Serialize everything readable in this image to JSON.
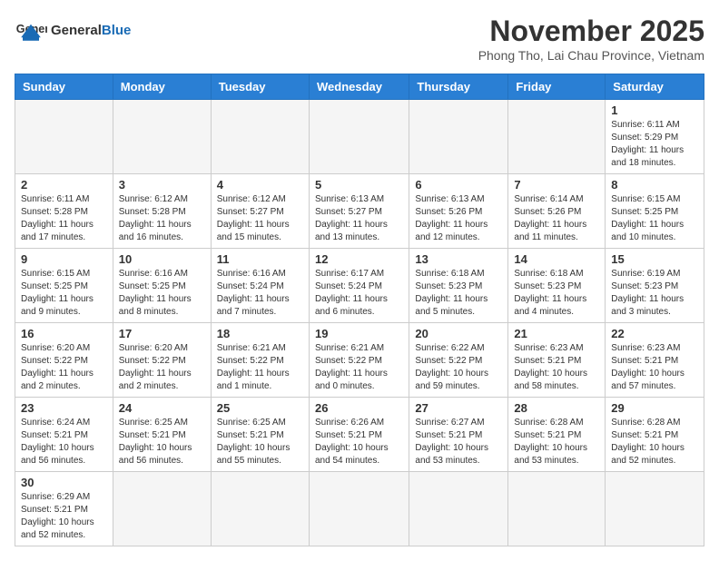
{
  "header": {
    "logo_general": "General",
    "logo_blue": "Blue",
    "month_year": "November 2025",
    "location": "Phong Tho, Lai Chau Province, Vietnam"
  },
  "weekdays": [
    "Sunday",
    "Monday",
    "Tuesday",
    "Wednesday",
    "Thursday",
    "Friday",
    "Saturday"
  ],
  "weeks": [
    [
      {
        "day": "",
        "info": ""
      },
      {
        "day": "",
        "info": ""
      },
      {
        "day": "",
        "info": ""
      },
      {
        "day": "",
        "info": ""
      },
      {
        "day": "",
        "info": ""
      },
      {
        "day": "",
        "info": ""
      },
      {
        "day": "1",
        "info": "Sunrise: 6:11 AM\nSunset: 5:29 PM\nDaylight: 11 hours and 18 minutes."
      }
    ],
    [
      {
        "day": "2",
        "info": "Sunrise: 6:11 AM\nSunset: 5:28 PM\nDaylight: 11 hours and 17 minutes."
      },
      {
        "day": "3",
        "info": "Sunrise: 6:12 AM\nSunset: 5:28 PM\nDaylight: 11 hours and 16 minutes."
      },
      {
        "day": "4",
        "info": "Sunrise: 6:12 AM\nSunset: 5:27 PM\nDaylight: 11 hours and 15 minutes."
      },
      {
        "day": "5",
        "info": "Sunrise: 6:13 AM\nSunset: 5:27 PM\nDaylight: 11 hours and 13 minutes."
      },
      {
        "day": "6",
        "info": "Sunrise: 6:13 AM\nSunset: 5:26 PM\nDaylight: 11 hours and 12 minutes."
      },
      {
        "day": "7",
        "info": "Sunrise: 6:14 AM\nSunset: 5:26 PM\nDaylight: 11 hours and 11 minutes."
      },
      {
        "day": "8",
        "info": "Sunrise: 6:15 AM\nSunset: 5:25 PM\nDaylight: 11 hours and 10 minutes."
      }
    ],
    [
      {
        "day": "9",
        "info": "Sunrise: 6:15 AM\nSunset: 5:25 PM\nDaylight: 11 hours and 9 minutes."
      },
      {
        "day": "10",
        "info": "Sunrise: 6:16 AM\nSunset: 5:25 PM\nDaylight: 11 hours and 8 minutes."
      },
      {
        "day": "11",
        "info": "Sunrise: 6:16 AM\nSunset: 5:24 PM\nDaylight: 11 hours and 7 minutes."
      },
      {
        "day": "12",
        "info": "Sunrise: 6:17 AM\nSunset: 5:24 PM\nDaylight: 11 hours and 6 minutes."
      },
      {
        "day": "13",
        "info": "Sunrise: 6:18 AM\nSunset: 5:23 PM\nDaylight: 11 hours and 5 minutes."
      },
      {
        "day": "14",
        "info": "Sunrise: 6:18 AM\nSunset: 5:23 PM\nDaylight: 11 hours and 4 minutes."
      },
      {
        "day": "15",
        "info": "Sunrise: 6:19 AM\nSunset: 5:23 PM\nDaylight: 11 hours and 3 minutes."
      }
    ],
    [
      {
        "day": "16",
        "info": "Sunrise: 6:20 AM\nSunset: 5:22 PM\nDaylight: 11 hours and 2 minutes."
      },
      {
        "day": "17",
        "info": "Sunrise: 6:20 AM\nSunset: 5:22 PM\nDaylight: 11 hours and 2 minutes."
      },
      {
        "day": "18",
        "info": "Sunrise: 6:21 AM\nSunset: 5:22 PM\nDaylight: 11 hours and 1 minute."
      },
      {
        "day": "19",
        "info": "Sunrise: 6:21 AM\nSunset: 5:22 PM\nDaylight: 11 hours and 0 minutes."
      },
      {
        "day": "20",
        "info": "Sunrise: 6:22 AM\nSunset: 5:22 PM\nDaylight: 10 hours and 59 minutes."
      },
      {
        "day": "21",
        "info": "Sunrise: 6:23 AM\nSunset: 5:21 PM\nDaylight: 10 hours and 58 minutes."
      },
      {
        "day": "22",
        "info": "Sunrise: 6:23 AM\nSunset: 5:21 PM\nDaylight: 10 hours and 57 minutes."
      }
    ],
    [
      {
        "day": "23",
        "info": "Sunrise: 6:24 AM\nSunset: 5:21 PM\nDaylight: 10 hours and 56 minutes."
      },
      {
        "day": "24",
        "info": "Sunrise: 6:25 AM\nSunset: 5:21 PM\nDaylight: 10 hours and 56 minutes."
      },
      {
        "day": "25",
        "info": "Sunrise: 6:25 AM\nSunset: 5:21 PM\nDaylight: 10 hours and 55 minutes."
      },
      {
        "day": "26",
        "info": "Sunrise: 6:26 AM\nSunset: 5:21 PM\nDaylight: 10 hours and 54 minutes."
      },
      {
        "day": "27",
        "info": "Sunrise: 6:27 AM\nSunset: 5:21 PM\nDaylight: 10 hours and 53 minutes."
      },
      {
        "day": "28",
        "info": "Sunrise: 6:28 AM\nSunset: 5:21 PM\nDaylight: 10 hours and 53 minutes."
      },
      {
        "day": "29",
        "info": "Sunrise: 6:28 AM\nSunset: 5:21 PM\nDaylight: 10 hours and 52 minutes."
      }
    ],
    [
      {
        "day": "30",
        "info": "Sunrise: 6:29 AM\nSunset: 5:21 PM\nDaylight: 10 hours and 52 minutes."
      },
      {
        "day": "",
        "info": ""
      },
      {
        "day": "",
        "info": ""
      },
      {
        "day": "",
        "info": ""
      },
      {
        "day": "",
        "info": ""
      },
      {
        "day": "",
        "info": ""
      },
      {
        "day": "",
        "info": ""
      }
    ]
  ]
}
